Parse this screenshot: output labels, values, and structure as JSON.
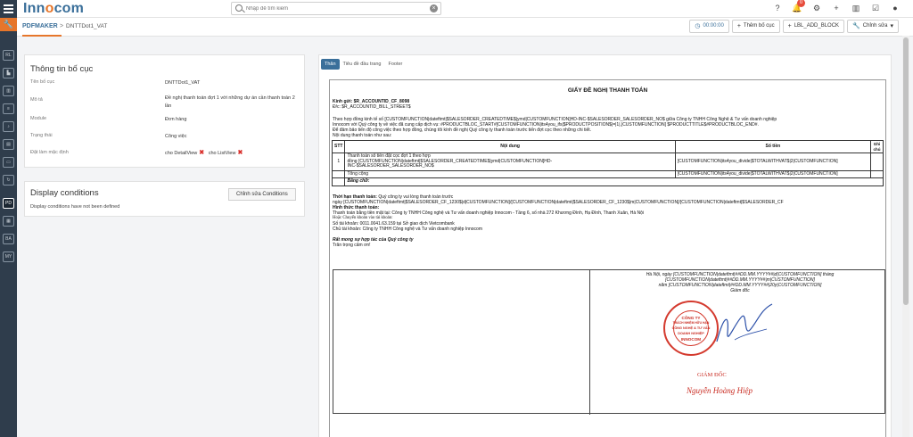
{
  "app": {
    "logo_prefix": "Inn",
    "logo_o": "o",
    "logo_suffix": "com"
  },
  "search": {
    "placeholder": "Nhập để tìm kiếm"
  },
  "header": {
    "notification_count": "0"
  },
  "sidebar": {
    "items": [
      "RL",
      "PD",
      "BA",
      "MY"
    ]
  },
  "breadcrumb": {
    "module": "PDFMAKER",
    "separator": ">",
    "page": "DNTTDot1_VAT"
  },
  "toolbar": {
    "timer": "00:00:00",
    "add_block": "Thêm bố cục",
    "add_lbl": "LBL_ADD_BLOCK",
    "edit": "Chỉnh sửa"
  },
  "info_panel": {
    "title": "Thông tin bố cục",
    "rows": [
      {
        "label": "Tên bố cục",
        "value": "DNTTDot1_VAT"
      },
      {
        "label": "Mô tả",
        "value": "Đề nghị thanh toán đợt 1 với những dự án cần thanh toán 2 lần"
      },
      {
        "label": "Module",
        "value": "Đơn hàng"
      },
      {
        "label": "Trạng thái",
        "value": "Công việc"
      },
      {
        "label": "Đặt làm mặc định",
        "value_detail": "cho DetailView",
        "value_list": "cho ListView"
      }
    ]
  },
  "conditions": {
    "title": "Display conditions",
    "subtitle": "Display conditions have not been defined",
    "button": "Chỉnh sửa Conditions"
  },
  "preview": {
    "tabs": [
      "Thân",
      "Tiêu đề đầu trang",
      "Footer"
    ],
    "doc_title": "GIẤY ĐỀ NGHỊ THANH TOÁN",
    "kinh_gui": "Kính gửi: $R_ACCOUNTID_CF_8098",
    "dia_chi": "Đ/c: $R_ACCOUNTID_BILL_STREET$",
    "para1": "Theo hợp đồng kinh tế số [CUSTOMFUNCTION|dateftmt|$SALESORDER_CREATEDTIME$|ymd|CUSTOMFUNCTION]HD-INC-$SALESORDER_SALESORDER_NO$ giữa Công ty TNHH Công Nghệ & Tư vấn doanh nghiệp",
    "para2": "Innocom với Quý công ty về việc đã cung cấp dịch vụ: #PRODUCTBLOC_START#[CUSTOMFUNCTION|its4you_ifs|$PRODUCTPOSITION$|=|1|,|CUSTOMFUNCTION] $PRODUCTTITLE$#PRODUCTBLOC_END#.",
    "para3": "Để đảm bảo tiến độ công việc theo hợp đồng, chúng tôi kính đề nghị Quý công ty thanh toán trước tiến đợt cọc theo những chi tiết.",
    "para4": "Nội dung thanh toán như sau:",
    "table": {
      "headers": [
        "STT",
        "Nội dung",
        "Số tiền",
        "Ghi chú"
      ],
      "row1_stt": "1",
      "row1_content_a": "Thanh toán số tiền đặt cọc đợt 1 theo hợp",
      "row1_content_b": "đồng [CUSTOMFUNCTION|dateftmt|$SALESORDER_CREATEDTIME$|ymd|CUSTOMFUNCTION]HD-",
      "row1_content_c": "INC-$SALESORDER_SALESORDER_NO$",
      "row1_amount": "[CUSTOMFUNCTION|its4you_divide|$TOTALWITHVAT$|2|CUSTOMFUNCTION]",
      "total_label": "Tổng cộng",
      "total_amount": "[CUSTOMFUNCTION|its4you_divide|$TOTALWITHVAT$|2|CUSTOMFUNCTION]",
      "words_label": "Bằng chữ:"
    },
    "term_label": "Thời hạn thanh toán:",
    "term_text": "Quý công ty vui lòng thanh toán trước",
    "term_date": "ngày [CUSTOMFUNCTION|dateftmt|$SALESORDER_CF_1230$|d|CUSTOMFUNCTION]/[CUSTOMFUNCTION|dateftmt|$SALESORDER_CF_1230$|m|CUSTOMFUNCTION]/[CUSTOMFUNCTION|dateftmt|$SALESORDER_CF",
    "method_label": "Hình thức thanh toán:",
    "method1": "Thanh toán bằng tiền mặt tại: Công ty TNHH Công nghệ và Tư vấn doanh nghiệp Innocom - Tầng 6, số nhà 272 Khương Đình, Hạ Đình, Thanh Xuân, Hà Nội",
    "method2": "Hoặc Chuyển khoản vào tài khoản:",
    "account": "Số tài khoản: 0011.0041.63.159 tại Sở giao dịch Vietcombank",
    "owner": "Chủ tài khoản: Công ty TNHH Công nghệ và Tư vấn doanh nghiệp Innocom",
    "hope": "Rất mong sự hợp tác của Quý công ty",
    "thanks": "Trân trọng cảm ơn!",
    "sig_line1": "Hà Nội, ngày [CUSTOMFUNCTION|dateftmt|##DD.MM.YYYY##|d|CUSTOMFUNCTION] tháng",
    "sig_line2": "[CUSTOMFUNCTION|dateftmt|##DD.MM.YYYY##|m|CUSTOMFUNCTION]",
    "sig_line3": "năm [CUSTOMFUNCTION|dateftmt|##DD.MM.YYYY##|20y|CUSTOMFUNCTION]",
    "sig_line4": "Giám đốc",
    "stamp": {
      "line1": "CÔNG TY",
      "line2": "TRÁCH NHIỆM HỮU HẠN",
      "line3": "CÔNG NGHỆ & TƯ VẤN",
      "line4": "DOANH NGHIỆP",
      "line5": "INNOCOM"
    },
    "sig_role": "GIÁM ĐỐC",
    "sig_name": "Nguyễn Hoàng Hiệp"
  },
  "colors": {
    "accent": "#e6762b",
    "brand": "#3a6f9a",
    "sidebar": "#2f3d4c",
    "stamp": "#d43a2e"
  }
}
